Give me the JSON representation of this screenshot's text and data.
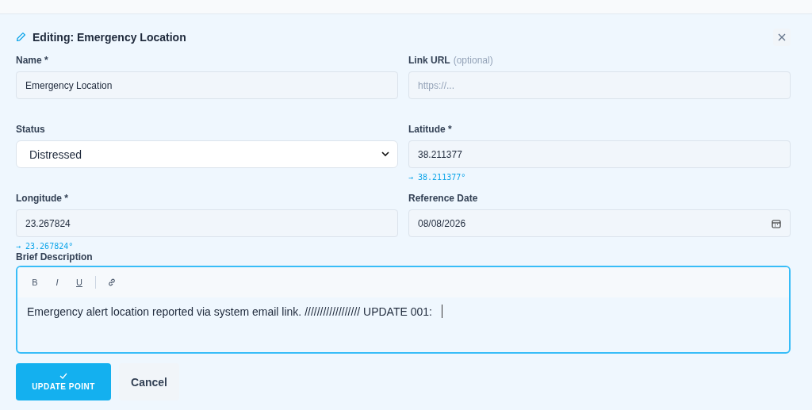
{
  "panel": {
    "title": "Editing: Emergency Location"
  },
  "fields": [
    {
      "kind": "text",
      "label": "Name *",
      "value": "Emergency Location"
    },
    {
      "kind": "text",
      "label": "Link URL",
      "label_note": "(optional)",
      "placeholder": "https://..."
    },
    {
      "kind": "select",
      "label": "Status",
      "value": "Distressed"
    },
    {
      "kind": "text",
      "label": "Latitude *",
      "value": "38.211377",
      "hint": "→ 38.211377°"
    },
    {
      "kind": "text",
      "label": "Longitude *",
      "value": "23.267824",
      "hint": "→ 23.267824°"
    },
    {
      "kind": "date",
      "label": "Reference Date",
      "value": "08/08/2026"
    }
  ],
  "description": {
    "label": "Brief Description",
    "toolbar": [
      {
        "kind": "bold",
        "label": "B"
      },
      {
        "kind": "italic",
        "label": "I"
      },
      {
        "kind": "underline",
        "label": "U"
      },
      {
        "kind": "link"
      }
    ],
    "text": "Emergency alert location reported via system email link. ////////////////// UPDATE 001:"
  },
  "buttons": [
    {
      "kind": "primary",
      "label": "UPDATE POINT"
    },
    {
      "kind": "secondary",
      "label": "Cancel"
    }
  ]
}
